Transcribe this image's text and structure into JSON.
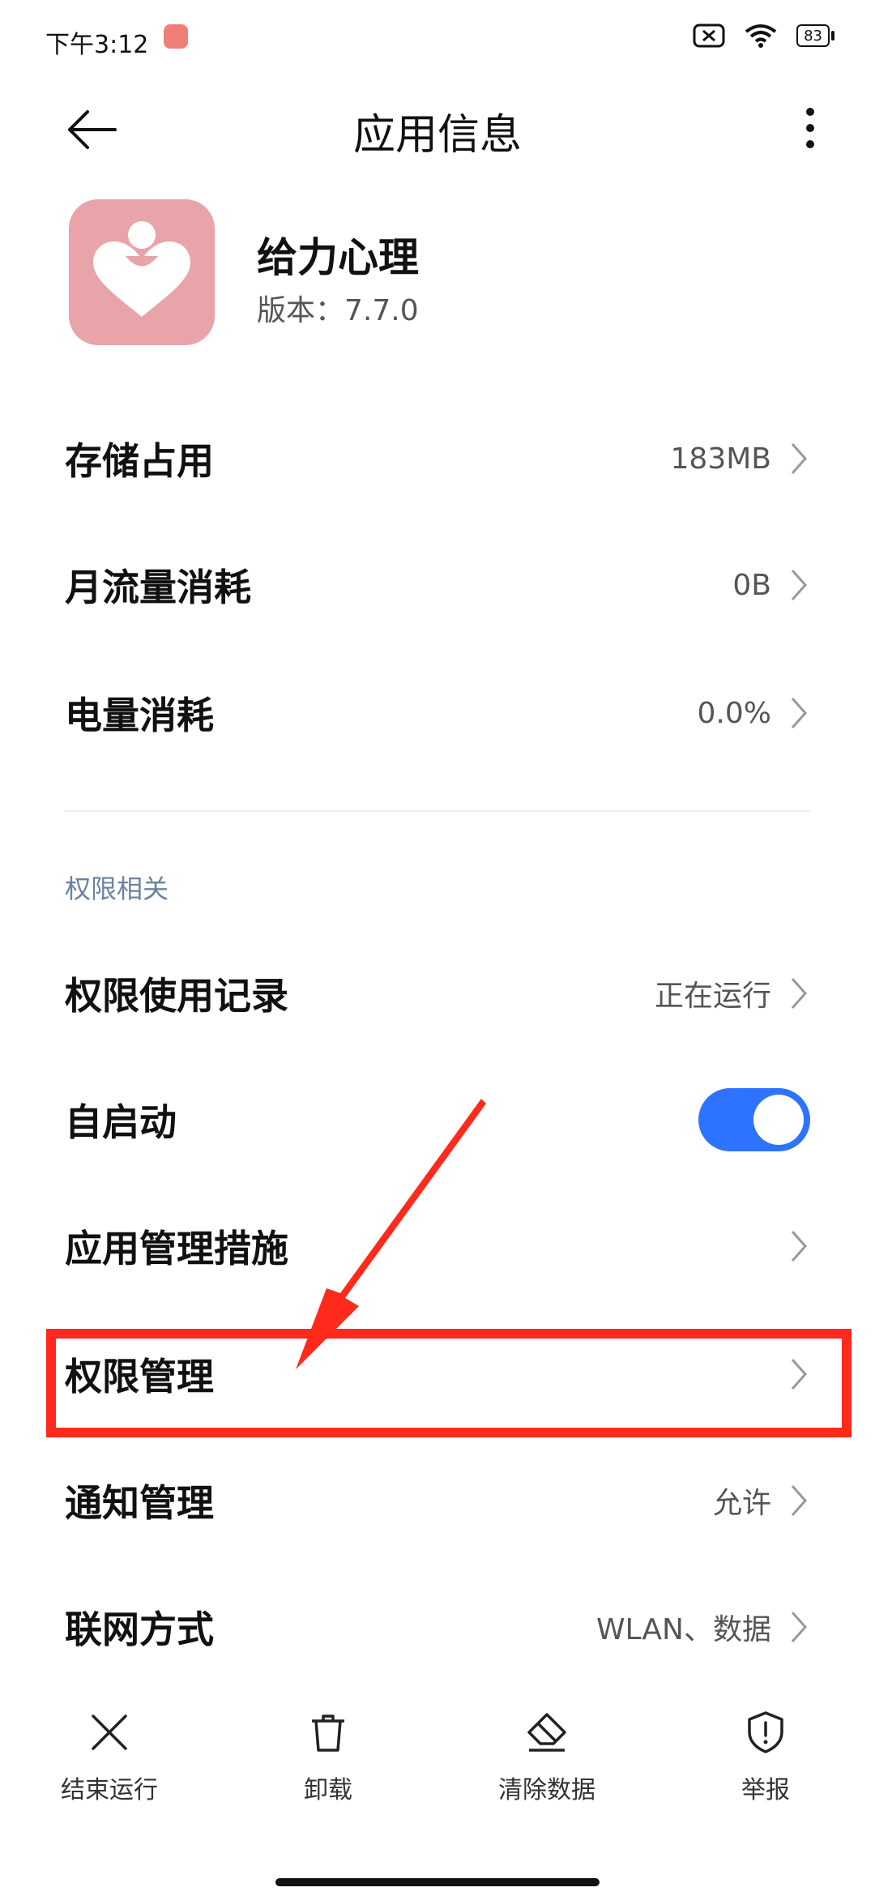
{
  "status_bar": {
    "time": "下午3:12",
    "battery": "83"
  },
  "header": {
    "title": "应用信息"
  },
  "app": {
    "name": "给力心理",
    "version_label": "版本：",
    "version": "7.7.0"
  },
  "usage_rows": [
    {
      "label": "存储占用",
      "value": "183MB"
    },
    {
      "label": "月流量消耗",
      "value": "0B"
    },
    {
      "label": "电量消耗",
      "value": "0.0%"
    }
  ],
  "permissions_section": {
    "title": "权限相关",
    "rows": [
      {
        "label": "权限使用记录",
        "value": "正在运行"
      },
      {
        "label": "自启动",
        "toggle_on": true
      },
      {
        "label": "应用管理措施",
        "value": ""
      },
      {
        "label": "权限管理",
        "value": ""
      },
      {
        "label": "通知管理",
        "value": "允许"
      },
      {
        "label": "联网方式",
        "value": "WLAN、数据"
      }
    ]
  },
  "bottom_actions": [
    {
      "label": "结束运行",
      "icon": "close-icon"
    },
    {
      "label": "卸载",
      "icon": "trash-icon"
    },
    {
      "label": "清除数据",
      "icon": "eraser-icon"
    },
    {
      "label": "举报",
      "icon": "shield-alert-icon"
    }
  ],
  "colors": {
    "toggle_on": "#2e73ff",
    "highlight": "#ff2a1b",
    "app_icon_bg": "#e8a4a8",
    "section_title": "#6b83a1"
  }
}
